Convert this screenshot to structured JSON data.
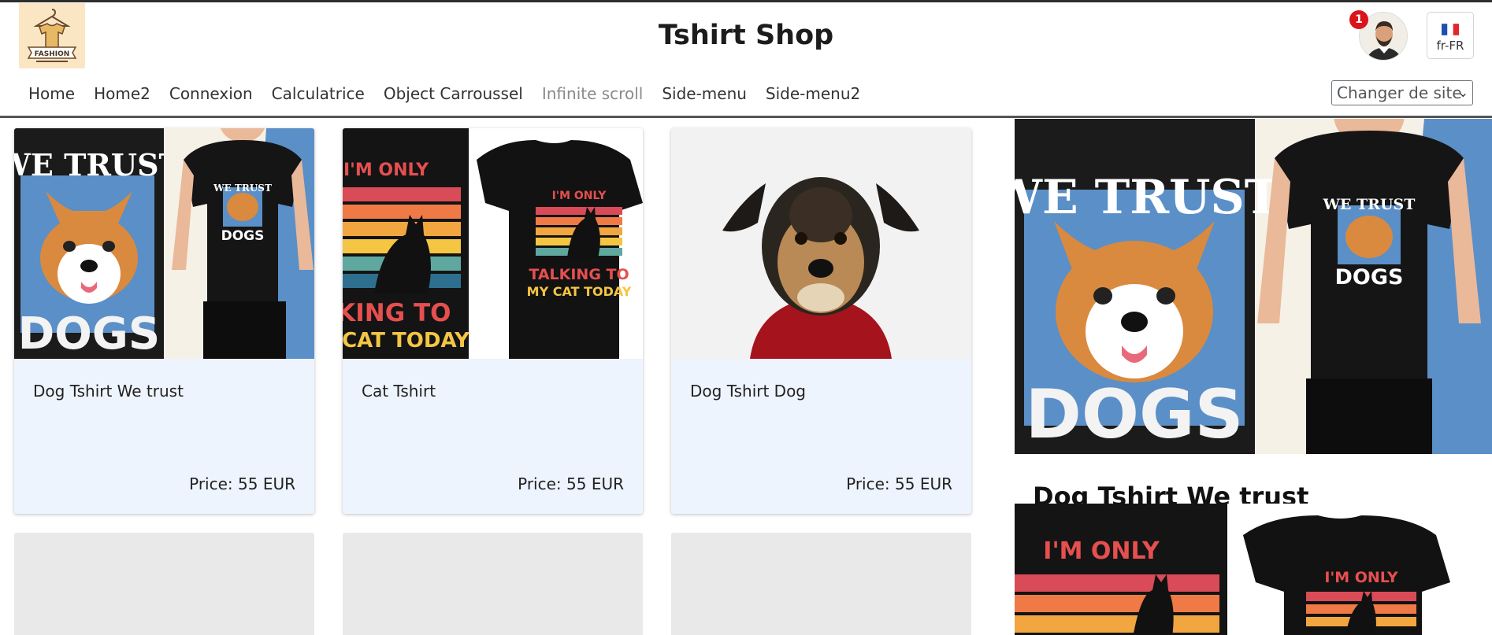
{
  "header": {
    "title": "Tshirt Shop",
    "logo_icon": "fashion-logo-icon",
    "logo_text": "FASHION",
    "notification_count": "1",
    "language": "fr-FR"
  },
  "nav": {
    "items": [
      {
        "label": "Home"
      },
      {
        "label": "Home2"
      },
      {
        "label": "Connexion"
      },
      {
        "label": "Calculatrice"
      },
      {
        "label": "Object Carroussel"
      },
      {
        "label": "Infinite scroll",
        "disabled": true
      },
      {
        "label": "Side-menu"
      },
      {
        "label": "Side-menu2"
      }
    ],
    "site_select": {
      "label": "Changer de site",
      "chevron": "⌄"
    }
  },
  "products": [
    {
      "name": "Dog Tshirt We trust",
      "price": "Price: 55 EUR",
      "image": "we-trust-dogs-tshirt",
      "art_top": "WE TRUST",
      "art_bottom": "DOGS"
    },
    {
      "name": "Cat Tshirt",
      "price": "Price: 55 EUR",
      "image": "cat-tshirt",
      "art_top": "I'M ONLY",
      "art_bottom": "TALKING TO",
      "art_bottom2": "MY CAT TODAY",
      "art_bottom_crop": "LKING TO",
      "art_bottom2_crop": "CAT TODAY"
    },
    {
      "name": "Dog Tshirt Dog",
      "price": "Price: 55 EUR",
      "image": "dog-photo"
    }
  ],
  "detail": {
    "title": "Dog Tshirt We trust"
  },
  "colors": {
    "badge": "#d9151b",
    "card_bg": "#eef4fd",
    "placeholder": "#e9e9e9"
  }
}
